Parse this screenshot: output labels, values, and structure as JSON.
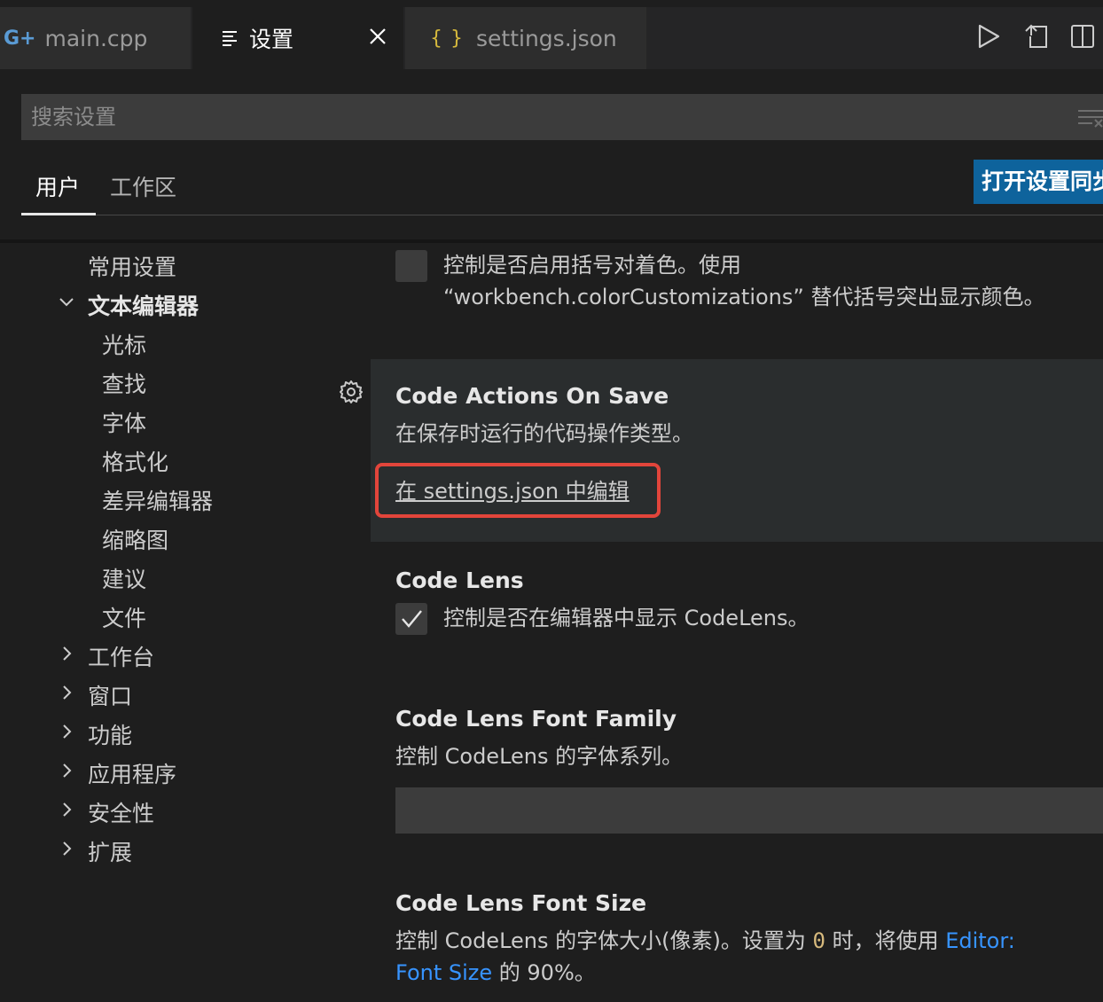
{
  "tabs": [
    {
      "label": "main.cpp",
      "icon": "cpp-icon"
    },
    {
      "label": "设置",
      "icon": "settings-list-icon"
    },
    {
      "label": "settings.json",
      "icon": "json-braces-icon"
    }
  ],
  "tab_icons": {
    "cpp": "G+",
    "json": "{ }"
  },
  "search": {
    "placeholder": "搜索设置"
  },
  "scope": {
    "user": "用户",
    "workspace": "工作区",
    "sync_button": "打开设置同步"
  },
  "toc": {
    "common": "常用设置",
    "text_editor": "文本编辑器",
    "children": [
      "光标",
      "查找",
      "字体",
      "格式化",
      "差异编辑器",
      "缩略图",
      "建议",
      "文件"
    ],
    "collapsed": [
      "工作台",
      "窗口",
      "功能",
      "应用程序",
      "安全性",
      "扩展"
    ]
  },
  "settings": {
    "bracket": {
      "desc_line1": "控制是否启用括号对着色。使用",
      "desc_line2": "“workbench.colorCustomizations” 替代括号突出显示颜色。",
      "checked": false
    },
    "code_actions": {
      "title": "Code Actions On Save",
      "desc": "在保存时运行的代码操作类型。",
      "link": "在 settings.json 中编辑"
    },
    "code_lens": {
      "title": "Code Lens",
      "desc": "控制是否在编辑器中显示 CodeLens。",
      "checked": true
    },
    "code_lens_font_family": {
      "title": "Code Lens Font Family",
      "desc": "控制 CodeLens 的字体系列。",
      "value": ""
    },
    "code_lens_font_size": {
      "title": "Code Lens Font Size",
      "desc_part1": "控制 CodeLens 的字体大小(像素)。设置为 ",
      "zero": "0",
      "desc_part2": " 时，将使用 ",
      "link_part1": "Editor:",
      "link_part2": "Font Size",
      "desc_part3": " 的 90%。"
    }
  },
  "colors": {
    "background": "#1e1e1e",
    "accent_button": "#0e639c",
    "highlight_box": "#e2453b",
    "link": "#3794ff"
  }
}
